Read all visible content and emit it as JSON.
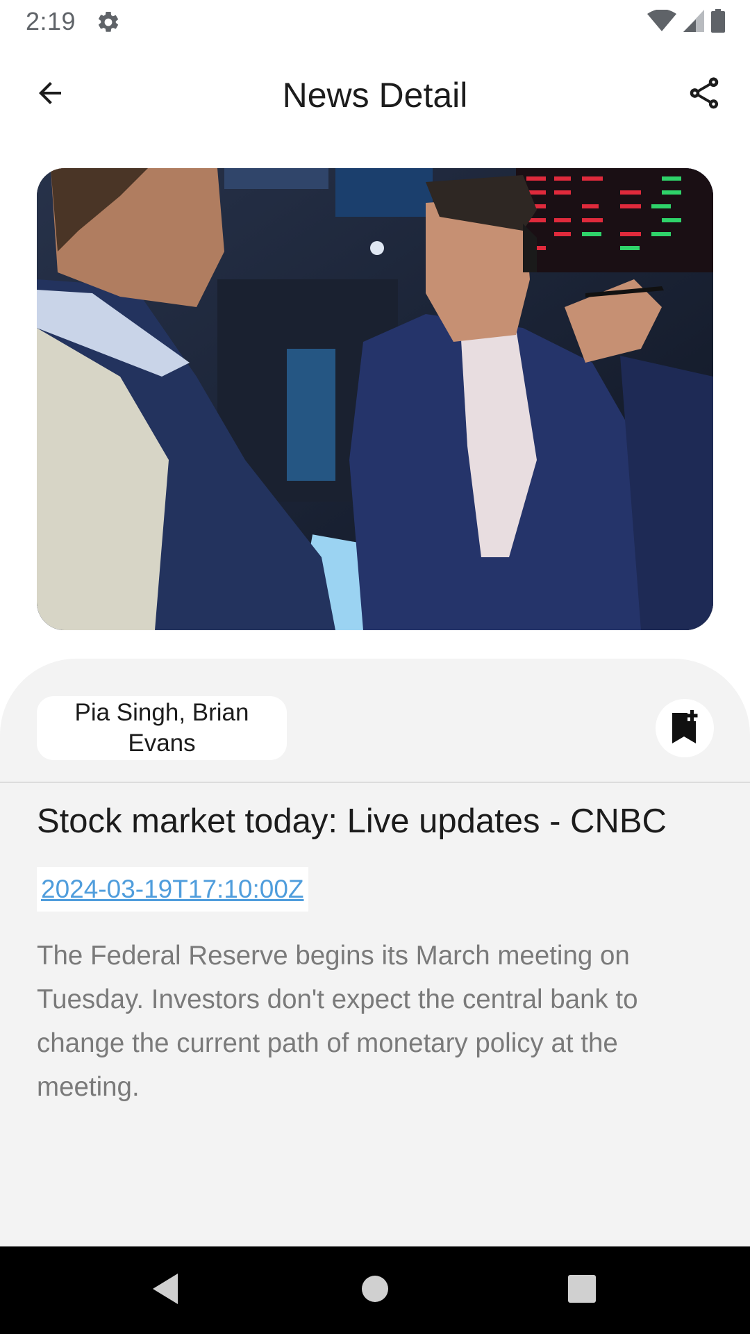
{
  "status_bar": {
    "time": "2:19",
    "icons": [
      "gear-icon",
      "wifi-icon",
      "signal-icon",
      "battery-icon"
    ]
  },
  "app_bar": {
    "title": "News Detail",
    "back_icon": "arrow-left-icon",
    "share_icon": "share-icon"
  },
  "article": {
    "image_description_icon": "news-photo",
    "authors": "Pia Singh, Brian Evans",
    "bookmark_icon": "bookmark-add-icon",
    "title": "Stock market today: Live updates - CNBC",
    "published_at": "2024-03-19T17:10:00Z",
    "description": "The Federal Reserve begins its March meeting on Tuesday. Investors don't expect the central bank to change the current path of monetary policy at the meeting."
  },
  "nav_bar": {
    "back_icon": "nav-back-icon",
    "home_icon": "nav-home-icon",
    "recents_icon": "nav-recents-icon"
  },
  "colors": {
    "sheet_background": "#f3f3f3",
    "link": "#4f9ddc",
    "description_text": "#7a7a7a",
    "nav_bar": "#000000"
  }
}
